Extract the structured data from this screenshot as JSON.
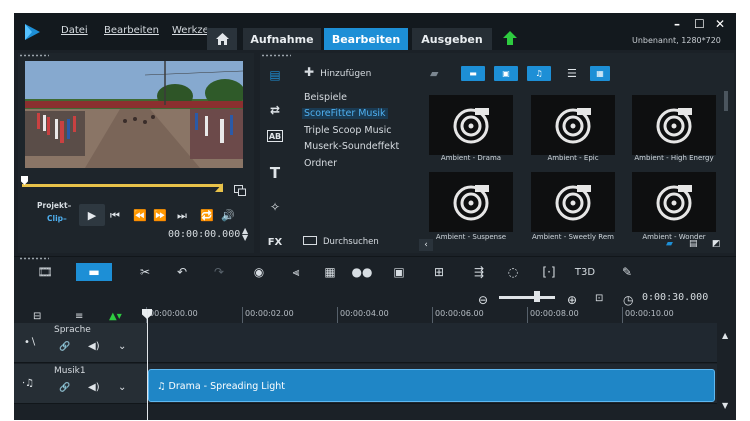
{
  "app": {
    "project_info": "Unbenannt, 1280*720"
  },
  "menu": {
    "file": "Datei",
    "edit": "Bearbeiten",
    "tools": "Werkze"
  },
  "tabs": [
    {
      "label": "Aufnahme"
    },
    {
      "label": "Bearbeiten"
    },
    {
      "label": "Ausgeben"
    }
  ],
  "window": {
    "minimize": "–",
    "maximize": "☐",
    "close": "✕"
  },
  "preview": {
    "project_label": "Projekt–",
    "clip_label": "Clip–",
    "timecode": "00:00:00.000"
  },
  "library": {
    "add_label": "Hinzufügen",
    "categories": [
      "Beispiele",
      "ScoreFitter Musik",
      "Triple Scoop Music",
      "Muserk-Soundeffekt",
      "Ordner"
    ],
    "selected_index": 1,
    "browse_label": "Durchsuchen",
    "side_icons": [
      "media-icon",
      "transition-icon",
      "ab-icon",
      "title-icon",
      "filter-icon",
      "fx-icon"
    ],
    "fx_label": "FX",
    "items": [
      {
        "label": "Ambient - Drama"
      },
      {
        "label": "Ambient - Epic"
      },
      {
        "label": "Ambient - High Energy"
      },
      {
        "label": "Ambient - Suspense"
      },
      {
        "label": "Ambient - Sweetly Rem"
      },
      {
        "label": "Ambient - Wonder"
      }
    ]
  },
  "zoom": {
    "duration": "0:00:30.000"
  },
  "ruler": {
    "labels": [
      "00:00:00.00",
      "00:00:02.00",
      "00:00:04.00",
      "00:00:06.00",
      "00:00:08.00",
      "00:00:10.00"
    ]
  },
  "tracks": [
    {
      "name": "Sprache"
    },
    {
      "name": "Musik1",
      "clip": "Drama - Spreading Light"
    }
  ],
  "colors": {
    "accent": "#1d8fd6",
    "background": "#1b2127",
    "clip": "#1f86c6"
  }
}
